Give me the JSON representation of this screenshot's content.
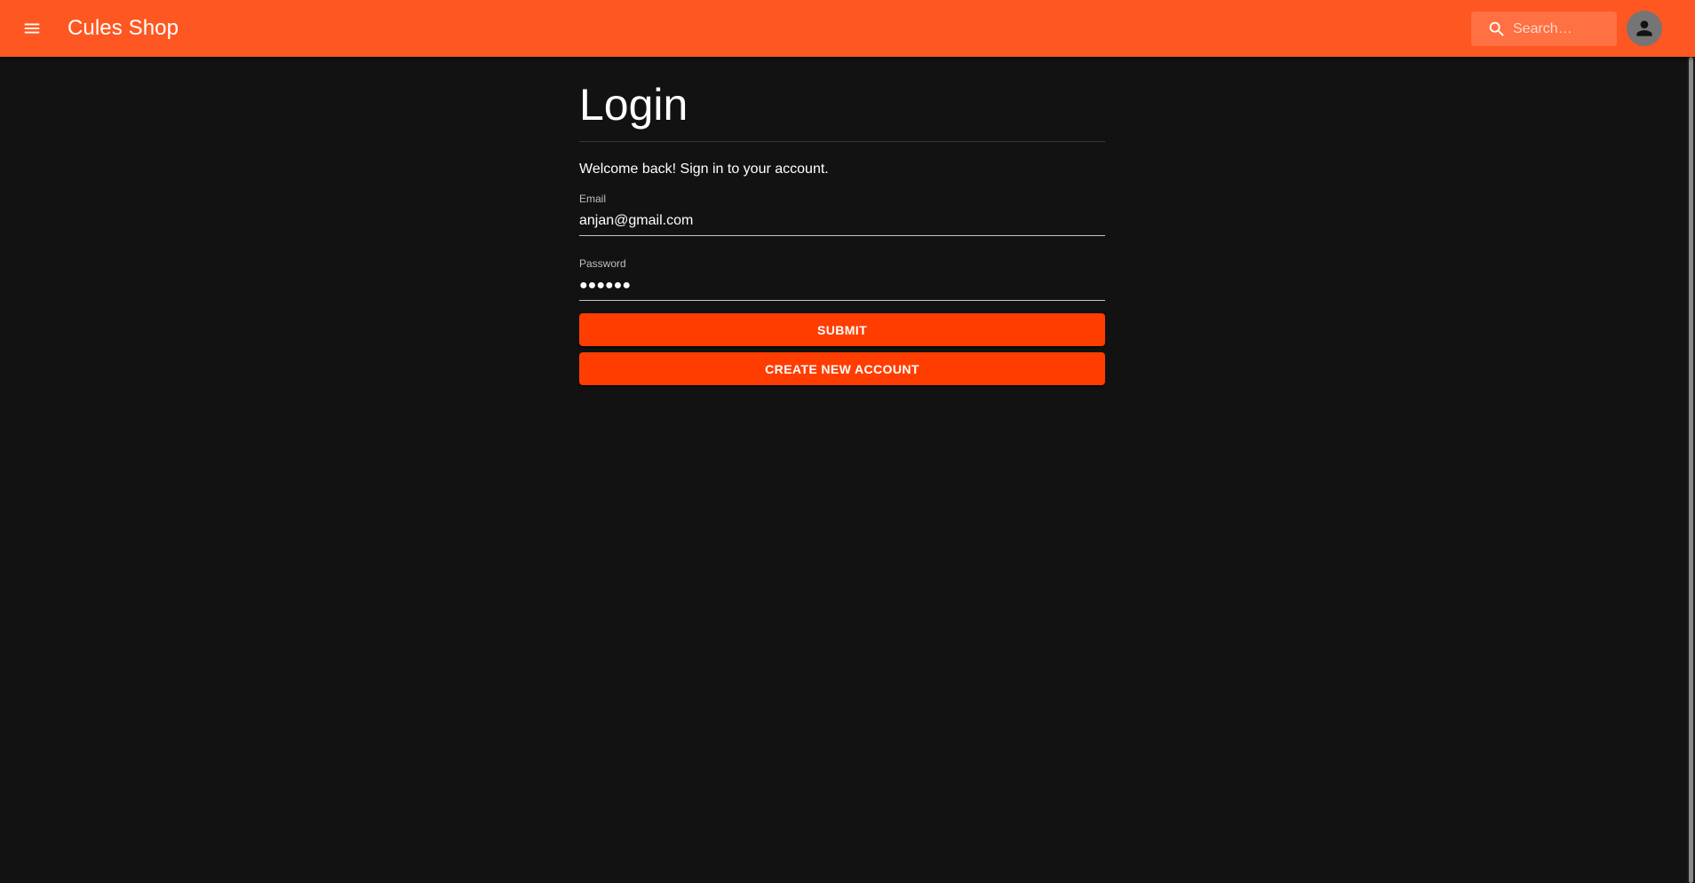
{
  "app": {
    "title": "Cules Shop",
    "accent_color": "#ff5722",
    "button_color": "#ff3d00",
    "background_color": "#121212"
  },
  "header": {
    "menu_icon": "hamburger-menu-icon",
    "search": {
      "placeholder": "Search…",
      "icon": "search-icon"
    },
    "account_icon": "account-circle-icon"
  },
  "login": {
    "title": "Login",
    "welcome_text": "Welcome back! Sign in to your account.",
    "email": {
      "label": "Email",
      "value": "anjan@gmail.com"
    },
    "password": {
      "label": "Password",
      "value": "●●●●●●"
    },
    "submit_label": "SUBMIT",
    "create_account_label": "CREATE NEW ACCOUNT"
  }
}
